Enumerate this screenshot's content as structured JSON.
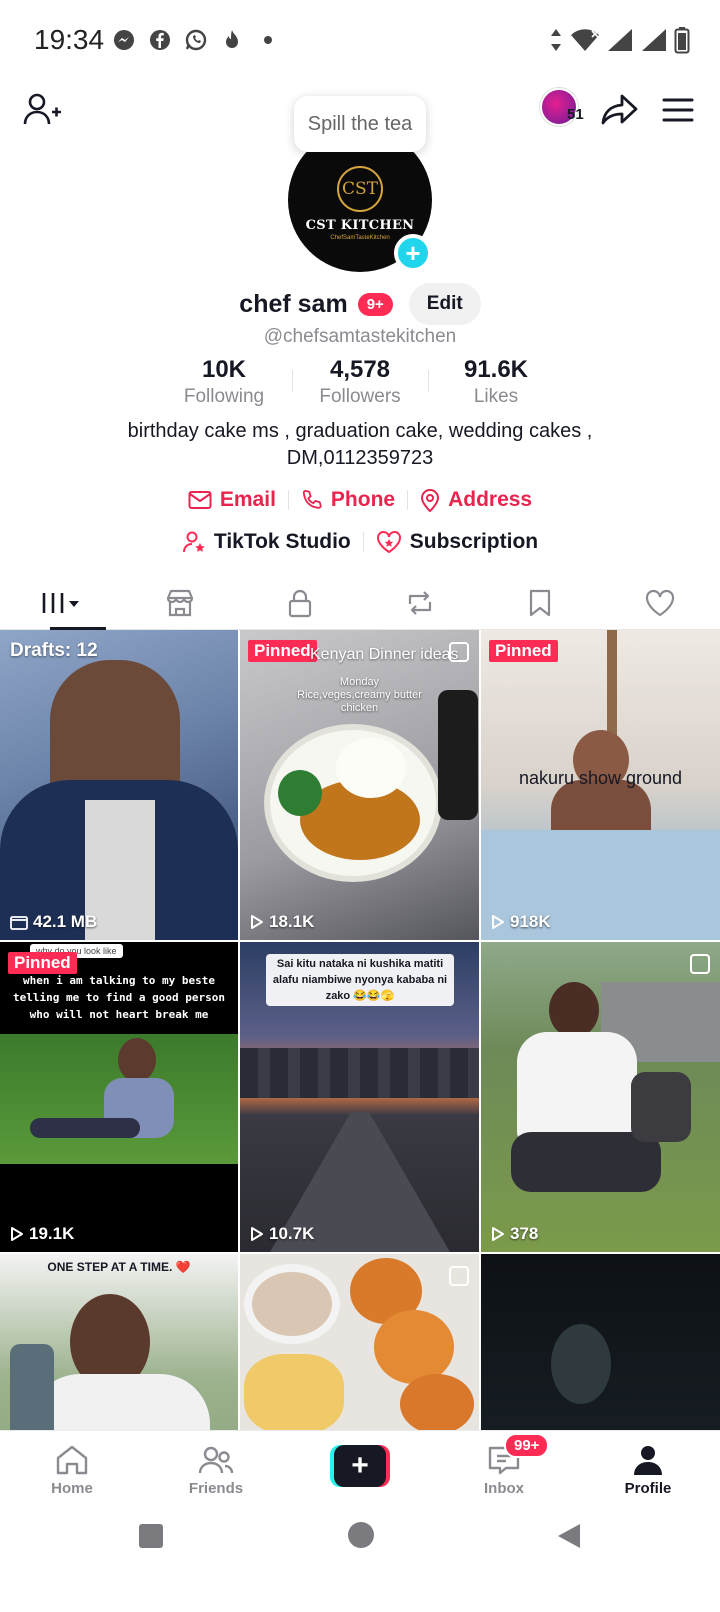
{
  "status_bar": {
    "time": "19:34",
    "left_icons": [
      "messenger-icon",
      "facebook-icon",
      "whatsapp-icon",
      "fire-icon",
      "dot-icon"
    ],
    "right_icons": [
      "data-arrows-icon",
      "wifi-icon",
      "signal-icon",
      "signal-icon",
      "battery-icon"
    ]
  },
  "top_nav": {
    "tooltip": "Spill the tea",
    "avatar_count": "51"
  },
  "profile": {
    "logo_mark": "CST",
    "logo_name": "CST KITCHEN",
    "logo_sub": "ChefSamTasteKitchen",
    "display_name": "chef sam",
    "notif_badge": "9+",
    "edit_label": "Edit",
    "username": "@chefsamtastekitchen",
    "stats": [
      {
        "value": "10K",
        "label": "Following"
      },
      {
        "value": "4,578",
        "label": "Followers"
      },
      {
        "value": "91.6K",
        "label": "Likes"
      }
    ],
    "bio_line1": "birthday cake ms , graduation cake, wedding cakes ,",
    "bio_line2": "DM,0112359723",
    "contacts": [
      {
        "label": "Email",
        "icon": "mail-icon"
      },
      {
        "label": "Phone",
        "icon": "phone-icon"
      },
      {
        "label": "Address",
        "icon": "location-pin-icon"
      }
    ],
    "tools": [
      {
        "label": "TikTok Studio",
        "icon": "user-star-icon"
      },
      {
        "label": "Subscription",
        "icon": "heart-star-icon"
      }
    ]
  },
  "tabs": [
    "videos-tab",
    "shop-tab",
    "private-tab",
    "reposts-tab",
    "favorites-tab",
    "liked-tab"
  ],
  "grid": [
    {
      "kind": "drafts",
      "tag": "Drafts: 12",
      "meta": "42.1 MB"
    },
    {
      "kind": "video",
      "tag": "Pinned",
      "title": "Kenyan Dinner ideas",
      "sub1": "Monday",
      "sub2": "Rice,veges,creamy butter",
      "sub3": "chicken",
      "views": "18.1K"
    },
    {
      "kind": "video",
      "tag": "Pinned",
      "caption": "nakuru  show ground",
      "views": "918K"
    },
    {
      "kind": "video",
      "tag": "Pinned",
      "reply": "why do you look like",
      "caption": "when i am talking to my beste telling me to find a good person who will not heart break me",
      "views": "19.1K"
    },
    {
      "kind": "video",
      "caption": "Sai kitu nataka ni  kushika matiti alafu niambiwe nyonya kababa ni zako 😂😂🫣",
      "views": "10.7K"
    },
    {
      "kind": "video",
      "views": "378"
    },
    {
      "kind": "video",
      "caption": "ONE STEP AT A TIME. ❤️"
    },
    {
      "kind": "video"
    },
    {
      "kind": "video"
    }
  ],
  "bottom_nav": {
    "home": "Home",
    "friends": "Friends",
    "create": "+",
    "inbox": "Inbox",
    "inbox_badge": "99+",
    "profile": "Profile"
  },
  "colors": {
    "accent": "#fe2c55",
    "link": "#e8254e",
    "cyan": "#25f4ee",
    "text": "#161823",
    "muted": "#8a8b91"
  }
}
